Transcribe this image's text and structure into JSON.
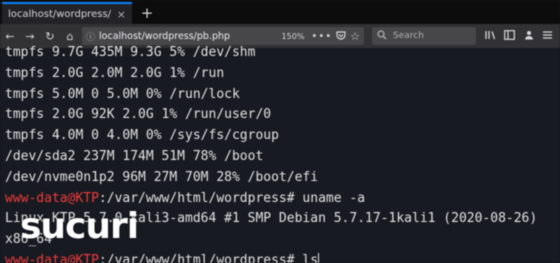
{
  "browser": {
    "tab_title": "localhost/wordpress/pb.php",
    "tab_close": "×",
    "new_tab": "+",
    "back": "←",
    "forward": "→",
    "reload": "↻",
    "home": "⌂",
    "url_info": "ⓘ",
    "url": "localhost/wordpress/pb.php",
    "zoom": "150%",
    "more": "•••",
    "bookmark": "☆",
    "search_placeholder": "Search"
  },
  "terminal": {
    "lines": [
      "tmpfs 9.7G 435M 9.3G 5% /dev/shm",
      "tmpfs 2.0G 2.0M 2.0G 1% /run",
      "tmpfs 5.0M 0 5.0M 0% /run/lock",
      "tmpfs 2.0G 92K 2.0G 1% /run/user/0",
      "tmpfs 4.0M 0 4.0M 0% /sys/fs/cgroup",
      "/dev/sda2 237M 174M 51M 78% /boot",
      "/dev/nvme0n1p2 96M 27M 70M 28% /boot/efi"
    ],
    "prompt1_user": "www-data@KTP",
    "prompt1_path": ":/var/www/html/wordpress# ",
    "prompt1_cmd": "uname -a",
    "uname_output": "Linux KTP 5.7.0-kali3-amd64 #1 SMP Debian 5.7.17-1kali1 (2020-08-26)",
    "uname_output_2": "x86_64",
    "prompt2_user": "www-data@KTP",
    "prompt2_path": ":/var/www/html/wordpress# ",
    "prompt2_cmd": "ls"
  },
  "watermark": {
    "text": "sucuri"
  },
  "colors": {
    "terminal_bg": "#171a21",
    "terminal_fg": "#e2e2e2",
    "prompt_user": "#ef3b3b",
    "tab_accent": "#0a84ff"
  }
}
